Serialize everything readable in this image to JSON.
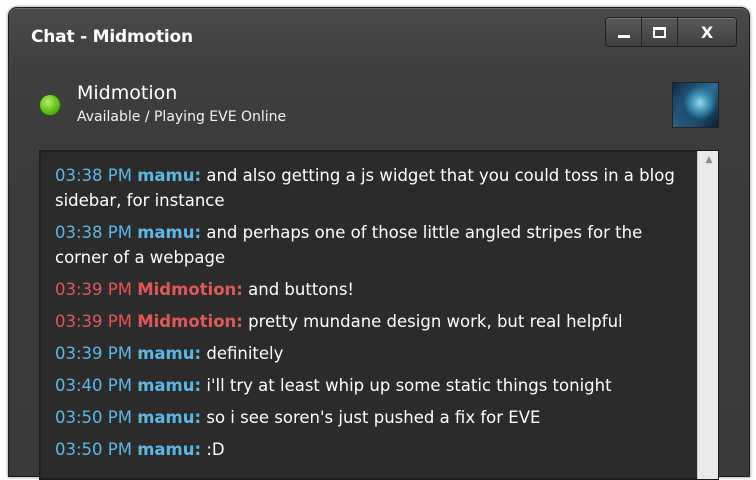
{
  "window": {
    "title": "Chat - Midmotion"
  },
  "contact": {
    "name": "Midmotion",
    "status": "Available / Playing EVE Online",
    "status_color": "#6cc820"
  },
  "colors": {
    "mamu": "#5bb7e6",
    "midmotion": "#e05757",
    "text": "#ffffff",
    "log_bg": "#2b2b2b"
  },
  "icons": {
    "minimize": "minimize-icon",
    "maximize": "maximize-icon",
    "close": "close-icon",
    "scroll_up": "scroll-up-arrow-icon"
  },
  "buttons": {
    "close_label": "X"
  },
  "messages": [
    {
      "time": "03:38 PM",
      "nick": "mamu:",
      "text": "and also getting a js widget that you could toss in a blog sidebar, for instance"
    },
    {
      "time": "03:38 PM",
      "nick": "mamu:",
      "text": "and perhaps one of those little angled stripes for the corner of a webpage"
    },
    {
      "time": "03:39 PM",
      "nick": "Midmotion:",
      "text": "and buttons!"
    },
    {
      "time": "03:39 PM",
      "nick": "Midmotion:",
      "text": "pretty mundane design work, but real helpful"
    },
    {
      "time": "03:39 PM",
      "nick": "mamu:",
      "text": "definitely"
    },
    {
      "time": "03:40 PM",
      "nick": "mamu:",
      "text": "i'll try at least whip up some static things tonight"
    },
    {
      "time": "03:50 PM",
      "nick": "mamu:",
      "text": "so i see soren's just pushed a fix for EVE"
    },
    {
      "time": "03:50 PM",
      "nick": "mamu:",
      "text": ":D"
    }
  ]
}
